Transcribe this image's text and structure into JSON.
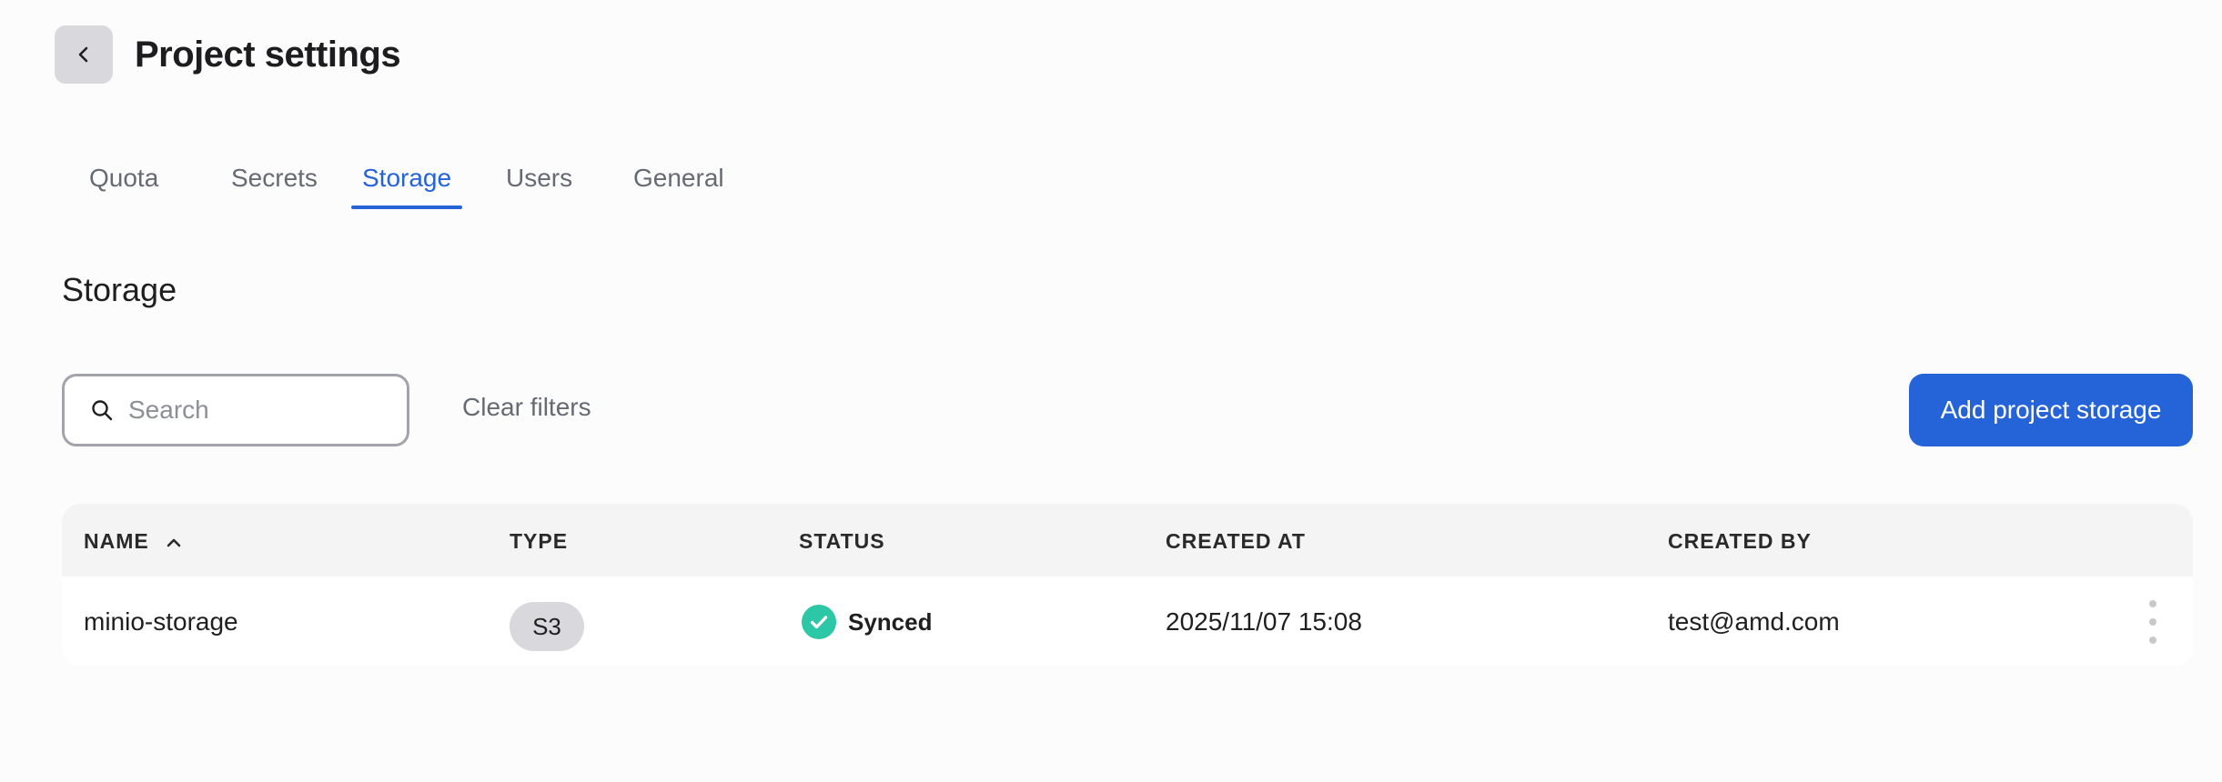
{
  "header": {
    "title": "Project settings"
  },
  "tabs": [
    {
      "label": "Quota",
      "active": false
    },
    {
      "label": "Secrets",
      "active": false
    },
    {
      "label": "Storage",
      "active": true
    },
    {
      "label": "Users",
      "active": false
    },
    {
      "label": "General",
      "active": false
    }
  ],
  "section": {
    "title": "Storage"
  },
  "toolbar": {
    "search_placeholder": "Search",
    "search_value": "",
    "clear_filters_label": "Clear filters",
    "add_button_label": "Add project storage"
  },
  "table": {
    "columns": [
      "NAME",
      "TYPE",
      "STATUS",
      "CREATED AT",
      "CREATED BY"
    ],
    "sort": {
      "column": "NAME",
      "direction": "ascending"
    },
    "rows": [
      {
        "name": "minio-storage",
        "type": "S3",
        "status": "Synced",
        "created_at": "2025/11/07 15:08",
        "created_by": "test@amd.com"
      }
    ]
  },
  "colors": {
    "accent": "#2563d8",
    "status_synced": "#2cc7a6",
    "chip_bg": "#d9d9dd",
    "page_bg": "#fcfcfc"
  },
  "icons": {
    "back": "chevron-left-icon",
    "search": "search-icon",
    "sort": "chevron-up-icon",
    "status": "check-circle-icon",
    "row_menu": "kebab-menu-icon"
  }
}
